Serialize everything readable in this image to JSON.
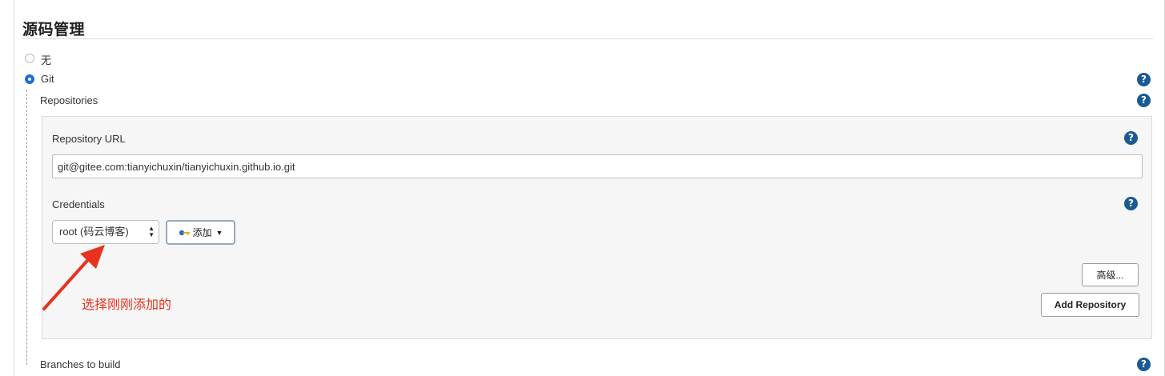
{
  "section": {
    "title": "源码管理"
  },
  "scm": {
    "options": [
      {
        "label": "无",
        "selected": false
      },
      {
        "label": "Git",
        "selected": true
      }
    ]
  },
  "repositories": {
    "label": "Repositories",
    "url_label": "Repository URL",
    "url_value": "git@gitee.com:tianyichuxin/tianyichuxin.github.io.git",
    "credentials_label": "Credentials",
    "credentials_selected": "root (码云博客)",
    "add_button_label": "添加",
    "advanced_button_label": "高级...",
    "add_repository_button_label": "Add Repository"
  },
  "annotation": {
    "text": "选择刚刚添加的",
    "color": "#e8321e"
  },
  "next_section_label": "Branches to build",
  "colors": {
    "radio_accent": "#1b6ed8",
    "help_icon": "#1a5a93",
    "annotation": "#e8321e"
  },
  "icons": {
    "help": "help-icon",
    "key": "key-icon",
    "caret": "caret-down-icon",
    "select_arrows": "select-arrows-icon"
  }
}
